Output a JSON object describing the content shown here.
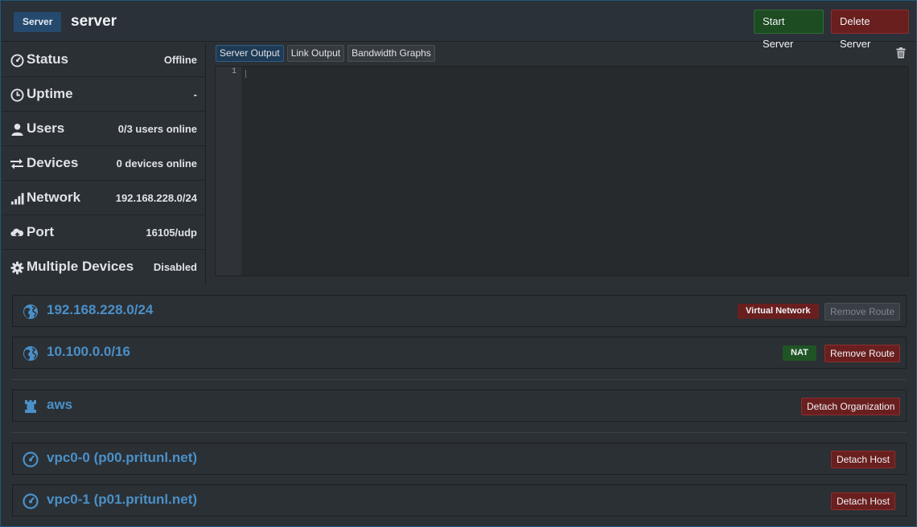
{
  "header": {
    "badge": "Server",
    "name": "server",
    "start_label": "Start Server",
    "delete_label": "Delete Server"
  },
  "stats": [
    {
      "label": "Status",
      "value": "Offline",
      "icon": "dashboard-icon"
    },
    {
      "label": "Uptime",
      "value": "-",
      "icon": "clock-icon"
    },
    {
      "label": "Users",
      "value": "0/3 users online",
      "icon": "user-icon"
    },
    {
      "label": "Devices",
      "value": "0 devices online",
      "icon": "transfer-icon"
    },
    {
      "label": "Network",
      "value": "192.168.228.0/24",
      "icon": "signal-icon"
    },
    {
      "label": "Port",
      "value": "16105/udp",
      "icon": "cloud-upload-icon"
    },
    {
      "label": "Multiple Devices",
      "value": "Disabled",
      "icon": "gear-icon"
    }
  ],
  "output": {
    "tabs": [
      "Server Output",
      "Link Output",
      "Bandwidth Graphs"
    ],
    "active_tab": "Server Output",
    "line_number": "1"
  },
  "routes": [
    {
      "network": "192.168.228.0/24",
      "tag": "Virtual Network",
      "button": "Remove Route",
      "button_disabled": true
    },
    {
      "network": "10.100.0.0/16",
      "tag": "NAT",
      "button": "Remove Route",
      "button_disabled": false
    }
  ],
  "organizations": [
    {
      "name": "aws",
      "button": "Detach Organization"
    }
  ],
  "hosts": [
    {
      "name": "vpc0-0 (p00.pritunl.net)",
      "button": "Detach Host"
    },
    {
      "name": "vpc0-1 (p01.pritunl.net)",
      "button": "Detach Host"
    }
  ],
  "colors": {
    "accent": "#4a90c8",
    "danger": "#6a1f1f",
    "success": "#1d4b22"
  }
}
